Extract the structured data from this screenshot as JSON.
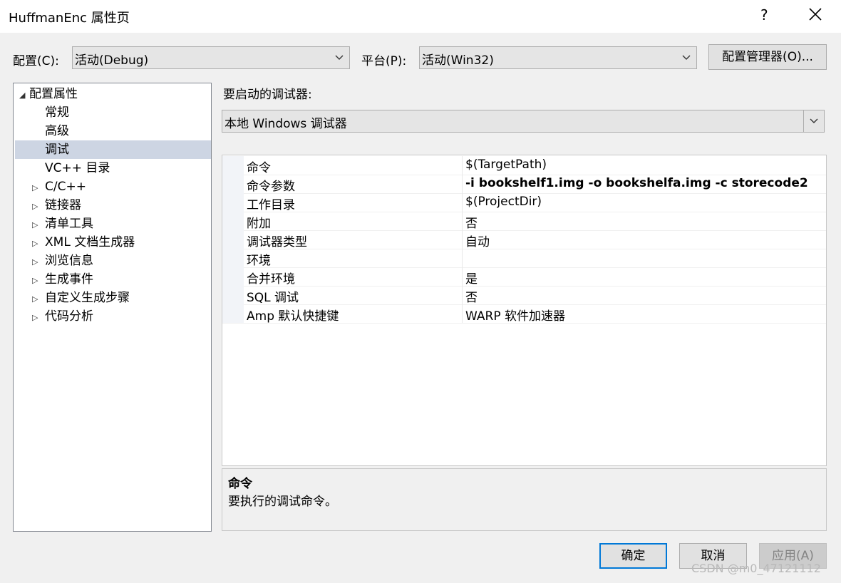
{
  "window": {
    "title": "HuffmanEnc 属性页",
    "help_glyph": "?",
    "close_icon": "close-icon"
  },
  "toolbar": {
    "config_label": "配置(C):",
    "config_value": "活动(Debug)",
    "platform_label": "平台(P):",
    "platform_value": "活动(Win32)",
    "config_manager_button": "配置管理器(O)..."
  },
  "tree": {
    "root": "配置属性",
    "items": [
      {
        "label": "常规",
        "expandable": false,
        "selected": false
      },
      {
        "label": "高级",
        "expandable": false,
        "selected": false
      },
      {
        "label": "调试",
        "expandable": false,
        "selected": true
      },
      {
        "label": "VC++ 目录",
        "expandable": false,
        "selected": false
      },
      {
        "label": "C/C++",
        "expandable": true,
        "selected": false
      },
      {
        "label": "链接器",
        "expandable": true,
        "selected": false
      },
      {
        "label": "清单工具",
        "expandable": true,
        "selected": false
      },
      {
        "label": "XML 文档生成器",
        "expandable": true,
        "selected": false
      },
      {
        "label": "浏览信息",
        "expandable": true,
        "selected": false
      },
      {
        "label": "生成事件",
        "expandable": true,
        "selected": false
      },
      {
        "label": "自定义生成步骤",
        "expandable": true,
        "selected": false
      },
      {
        "label": "代码分析",
        "expandable": true,
        "selected": false
      }
    ]
  },
  "debugger": {
    "label": "要启动的调试器:",
    "value": "本地 Windows 调试器"
  },
  "properties": [
    {
      "name": "命令",
      "value": "$(TargetPath)",
      "bold": false
    },
    {
      "name": "命令参数",
      "value": "-i bookshelf1.img -o bookshelfa.img -c storecode2",
      "bold": true
    },
    {
      "name": "工作目录",
      "value": "$(ProjectDir)",
      "bold": false
    },
    {
      "name": "附加",
      "value": "否",
      "bold": false
    },
    {
      "name": "调试器类型",
      "value": "自动",
      "bold": false
    },
    {
      "name": "环境",
      "value": "",
      "bold": false
    },
    {
      "name": "合并环境",
      "value": "是",
      "bold": false
    },
    {
      "name": "SQL 调试",
      "value": "否",
      "bold": false
    },
    {
      "name": "Amp 默认快捷键",
      "value": "WARP 软件加速器",
      "bold": false
    }
  ],
  "description": {
    "title": "命令",
    "text": "要执行的调试命令。"
  },
  "buttons": {
    "ok": "确定",
    "cancel": "取消",
    "apply": "应用(A)"
  },
  "watermark": "CSDN @m0_47121112"
}
